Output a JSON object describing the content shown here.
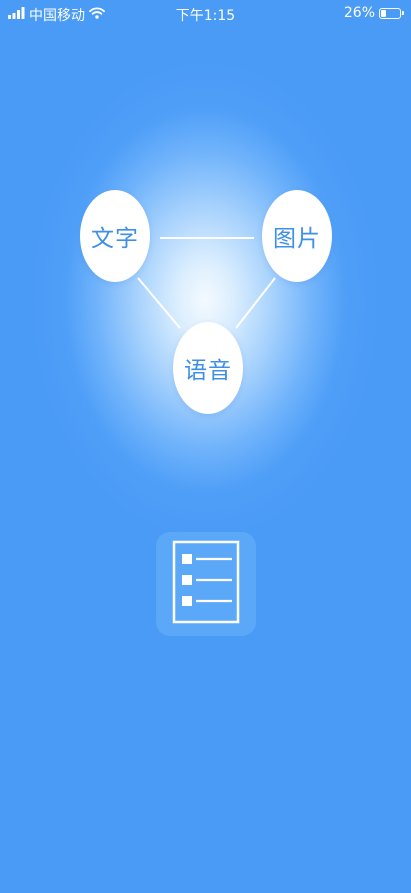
{
  "status_bar": {
    "carrier": "中国移动",
    "time": "下午1:15",
    "battery_percent": "26%",
    "battery_level": 0.26,
    "icons": [
      "signal-icon",
      "wifi-icon",
      "battery-icon"
    ]
  },
  "nodes": {
    "text": {
      "label": "文字"
    },
    "image": {
      "label": "图片"
    },
    "voice": {
      "label": "语音"
    }
  },
  "list_button": {
    "icon": "list-icon"
  },
  "colors": {
    "background_blue": "#4a9bf6",
    "glow_center": "#f4faff",
    "node_text": "#3d8fe8",
    "foreground": "#ffffff"
  }
}
